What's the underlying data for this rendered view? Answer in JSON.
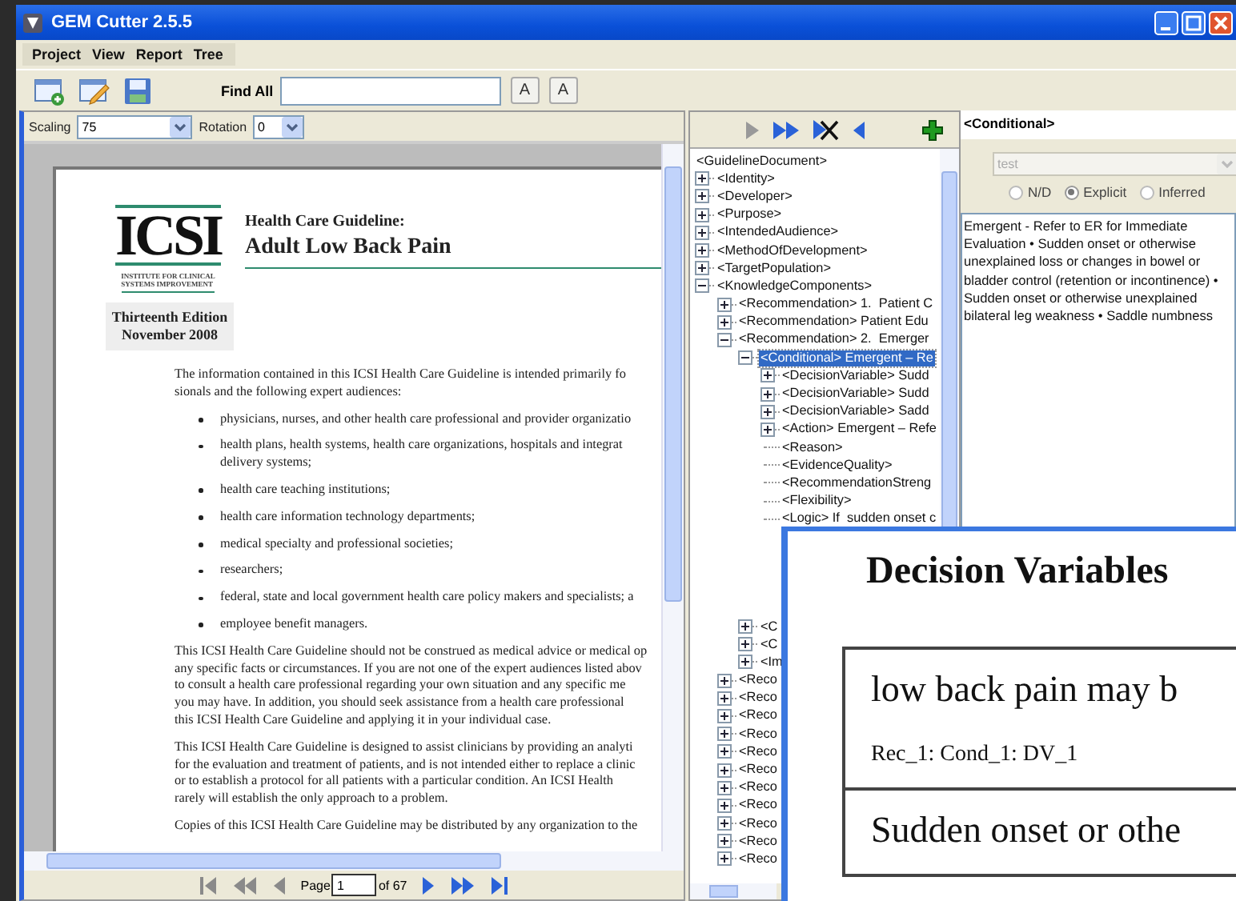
{
  "window": {
    "title": "GEM Cutter 2.5.5"
  },
  "menu": [
    "Project",
    "View",
    "Report",
    "Tree"
  ],
  "toolbar": {
    "find_label": "Find All",
    "font_buttons": [
      "A",
      "A"
    ]
  },
  "viewer": {
    "scaling_label": "Scaling",
    "scaling_value": "75",
    "rotation_label": "Rotation",
    "rotation_value": "0",
    "document": {
      "logo": "ICSI",
      "institute": [
        "INSTITUTE FOR CLINICAL",
        "SYSTEMS IMPROVEMENT"
      ],
      "kicker": "Health Care Guideline:",
      "title": "Adult Low Back Pain",
      "edition": [
        "Thirteenth Edition",
        "November 2008"
      ],
      "blocks": [
        {
          "kind": "paragraph",
          "lines": [
            "The information contained in this ICSI Health Care Guideline is intended primarily fo",
            "sionals and the following expert audiences:"
          ]
        },
        {
          "kind": "bullet",
          "lines": [
            "physicians, nurses, and other health care professional and provider organizatio"
          ]
        },
        {
          "kind": "bullet",
          "lines": [
            "health plans, health systems, health care organizations, hospitals and integrat",
            "delivery systems;"
          ]
        },
        {
          "kind": "bullet",
          "lines": [
            "health care teaching institutions;"
          ]
        },
        {
          "kind": "bullet",
          "lines": [
            "health care information technology departments;"
          ]
        },
        {
          "kind": "bullet",
          "lines": [
            "medical specialty and professional societies;"
          ]
        },
        {
          "kind": "bullet",
          "lines": [
            "researchers;"
          ]
        },
        {
          "kind": "bullet",
          "lines": [
            "federal, state and local government health care policy makers and specialists; a"
          ]
        },
        {
          "kind": "bullet",
          "lines": [
            "employee benefit managers."
          ]
        },
        {
          "kind": "paragraph",
          "lines": [
            "This ICSI Health Care Guideline should not be construed as medical advice or medical op",
            "any specific facts or circumstances.  If you are not one of the expert audiences listed abov",
            "to consult a health care professional regarding your own situation and any specific me",
            "you may have. In addition, you should seek assistance from a health care professional",
            "this ICSI Health Care Guideline and applying it in your individual case."
          ]
        },
        {
          "kind": "paragraph",
          "lines": [
            "This ICSI Health Care Guideline is designed to assist clinicians by providing an analyti",
            "for the evaluation and treatment of patients, and is not intended either to replace a clinic",
            "or to establish a protocol for all patients with a particular condition.  An ICSI Health",
            "rarely will establish the only approach to a problem."
          ]
        },
        {
          "kind": "paragraph",
          "lines": [
            "Copies of this ICSI Health Care Guideline may be distributed by any organization to the"
          ]
        }
      ]
    },
    "pager": {
      "label": "Page",
      "value": "1",
      "total": "of 67"
    }
  },
  "tree": {
    "items": [
      {
        "label": "<GuidelineDocument>",
        "selected": false,
        "children": [
          {
            "label": "<Identity>",
            "expanded": false,
            "selected": false
          },
          {
            "label": "<Developer>",
            "expanded": false,
            "selected": false
          },
          {
            "label": "<Purpose>",
            "expanded": false,
            "selected": false
          },
          {
            "label": "<IntendedAudience>",
            "expanded": false,
            "selected": false
          },
          {
            "label": "<MethodOfDevelopment>",
            "expanded": false,
            "selected": false
          },
          {
            "label": "<TargetPopulation>",
            "expanded": false,
            "selected": false
          },
          {
            "label": "<KnowledgeComponents>",
            "expanded": true,
            "selected": false,
            "children": [
              {
                "label": "<Recommendation> 1.  Patient C",
                "expanded": false,
                "selected": false
              },
              {
                "label": "<Recommendation> Patient Edu",
                "expanded": false,
                "selected": false
              },
              {
                "label": "<Recommendation> 2.  Emerger",
                "expanded": true,
                "selected": false,
                "children": [
                  {
                    "label": "<Conditional> Emergent – Re",
                    "expanded": true,
                    "selected": true,
                    "children": [
                      {
                        "label": "<DecisionVariable> Sudd",
                        "expanded": false,
                        "selected": false
                      },
                      {
                        "label": "<DecisionVariable> Sudd",
                        "expanded": false,
                        "selected": false
                      },
                      {
                        "label": "<DecisionVariable> Sadd",
                        "expanded": false,
                        "selected": false
                      },
                      {
                        "label": "<Action> Emergent – Refe",
                        "expanded": false,
                        "selected": false
                      },
                      {
                        "label": "<Reason>",
                        "selected": false
                      },
                      {
                        "label": "<EvidenceQuality>",
                        "selected": false
                      },
                      {
                        "label": "<RecommendationStreng",
                        "selected": false
                      },
                      {
                        "label": "<Flexibility>",
                        "selected": false
                      },
                      {
                        "label": "<Logic> If  sudden onset c",
                        "selected": false
                      }
                    ]
                  },
                  {
                    "label": "<C",
                    "expanded": false,
                    "selected": false
                  },
                  {
                    "label": "<C",
                    "expanded": false,
                    "selected": false
                  },
                  {
                    "label": "<Im",
                    "expanded": false,
                    "selected": false
                  }
                ]
              },
              {
                "label": "<Reco",
                "expanded": false,
                "selected": false
              },
              {
                "label": "<Reco",
                "expanded": false,
                "selected": false
              },
              {
                "label": "<Reco",
                "expanded": false,
                "selected": false
              },
              {
                "label": "<Reco",
                "expanded": false,
                "selected": false
              },
              {
                "label": "<Reco",
                "expanded": false,
                "selected": false
              },
              {
                "label": "<Reco",
                "expanded": false,
                "selected": false
              },
              {
                "label": "<Reco",
                "expanded": false,
                "selected": false
              },
              {
                "label": "<Reco",
                "expanded": false,
                "selected": false
              },
              {
                "label": "<Reco",
                "expanded": false,
                "selected": false
              },
              {
                "label": "<Reco",
                "expanded": false,
                "selected": false
              },
              {
                "label": "<Reco",
                "expanded": false,
                "selected": false
              }
            ]
          }
        ]
      }
    ]
  },
  "properties": {
    "title": "<Conditional>",
    "combo": {
      "value": "test",
      "disabled": true
    },
    "radios": [
      {
        "label": "N/D",
        "selected": false
      },
      {
        "label": "Explicit",
        "selected": true
      },
      {
        "label": "Inferred",
        "selected": false
      }
    ],
    "text_lines": [
      "Emergent - Refer to ER for Immediate",
      "Evaluation • Sudden onset or otherwise",
      "unexplained loss or changes in bowel or",
      "bladder control (retention or incontinence) •",
      "Sudden onset or otherwise unexplained",
      "bilateral leg weakness • Saddle numbness"
    ]
  },
  "popup": {
    "title": "Decision Variables",
    "rows": [
      {
        "text": "low back pain may b",
        "ref": "Rec_1: Cond_1: DV_1"
      },
      {
        "text": "Sudden onset or othe"
      }
    ]
  }
}
